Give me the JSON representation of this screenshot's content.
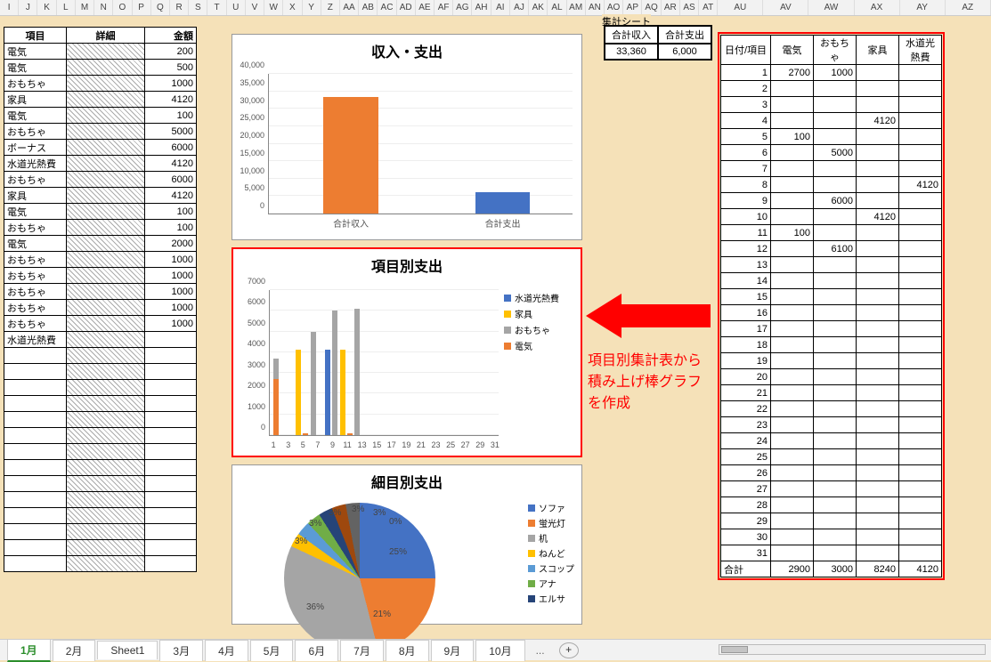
{
  "col_headers": [
    "I",
    "J",
    "K",
    "L",
    "M",
    "N",
    "O",
    "P",
    "Q",
    "R",
    "S",
    "T",
    "U",
    "V",
    "W",
    "X",
    "Y",
    "Z",
    "AA",
    "AB",
    "AC",
    "AD",
    "AE",
    "AF",
    "AG",
    "AH",
    "AI",
    "AJ",
    "AK",
    "AL",
    "AM",
    "AN",
    "AO",
    "AP",
    "AQ",
    "AR",
    "AS",
    "AT",
    "AU",
    "AV",
    "AW",
    "AX",
    "AY",
    "AZ"
  ],
  "left_table": {
    "headers": [
      "項目",
      "詳細",
      "金額"
    ],
    "rows": [
      [
        "電気",
        "",
        200
      ],
      [
        "電気",
        "",
        500
      ],
      [
        "おもちゃ",
        "",
        1000
      ],
      [
        "家具",
        "",
        4120
      ],
      [
        "電気",
        "",
        100
      ],
      [
        "おもちゃ",
        "",
        5000
      ],
      [
        "ボーナス",
        "",
        6000
      ],
      [
        "水道光熱費",
        "",
        4120
      ],
      [
        "おもちゃ",
        "",
        6000
      ],
      [
        "家具",
        "",
        4120
      ],
      [
        "電気",
        "",
        100
      ],
      [
        "おもちゃ",
        "",
        100
      ],
      [
        "電気",
        "",
        2000
      ],
      [
        "おもちゃ",
        "",
        1000
      ],
      [
        "おもちゃ",
        "",
        1000
      ],
      [
        "おもちゃ",
        "",
        1000
      ],
      [
        "おもちゃ",
        "",
        1000
      ],
      [
        "おもちゃ",
        "",
        1000
      ],
      [
        "水道光熱費",
        "",
        ""
      ],
      [
        "",
        "",
        ""
      ],
      [
        "",
        "",
        ""
      ],
      [
        "",
        "",
        ""
      ],
      [
        "",
        "",
        ""
      ],
      [
        "",
        "",
        ""
      ],
      [
        "",
        "",
        ""
      ],
      [
        "",
        "",
        ""
      ],
      [
        "",
        "",
        ""
      ],
      [
        "",
        "",
        ""
      ],
      [
        "",
        "",
        ""
      ],
      [
        "",
        "",
        ""
      ],
      [
        "",
        "",
        ""
      ],
      [
        "",
        "",
        ""
      ],
      [
        "",
        "",
        ""
      ]
    ]
  },
  "summary": {
    "title": "集計シート",
    "headers": [
      "合計収入",
      "合計支出"
    ],
    "values": [
      "33,360",
      "6,000"
    ]
  },
  "pivot": {
    "headers": [
      "日付/項目",
      "電気",
      "おもちゃ",
      "家具",
      "水道光熱費"
    ],
    "rows": [
      [
        1,
        2700,
        1000,
        "",
        ""
      ],
      [
        2,
        "",
        "",
        "",
        ""
      ],
      [
        3,
        "",
        "",
        "",
        ""
      ],
      [
        4,
        "",
        "",
        4120,
        ""
      ],
      [
        5,
        100,
        "",
        "",
        ""
      ],
      [
        6,
        "",
        5000,
        "",
        ""
      ],
      [
        7,
        "",
        "",
        "",
        ""
      ],
      [
        8,
        "",
        "",
        "",
        4120
      ],
      [
        9,
        "",
        6000,
        "",
        ""
      ],
      [
        10,
        "",
        "",
        4120,
        ""
      ],
      [
        11,
        100,
        "",
        "",
        ""
      ],
      [
        12,
        "",
        6100,
        "",
        ""
      ],
      [
        13,
        "",
        "",
        "",
        ""
      ],
      [
        14,
        "",
        "",
        "",
        ""
      ],
      [
        15,
        "",
        "",
        "",
        ""
      ],
      [
        16,
        "",
        "",
        "",
        ""
      ],
      [
        17,
        "",
        "",
        "",
        ""
      ],
      [
        18,
        "",
        "",
        "",
        ""
      ],
      [
        19,
        "",
        "",
        "",
        ""
      ],
      [
        20,
        "",
        "",
        "",
        ""
      ],
      [
        21,
        "",
        "",
        "",
        ""
      ],
      [
        22,
        "",
        "",
        "",
        ""
      ],
      [
        23,
        "",
        "",
        "",
        ""
      ],
      [
        24,
        "",
        "",
        "",
        ""
      ],
      [
        25,
        "",
        "",
        "",
        ""
      ],
      [
        26,
        "",
        "",
        "",
        ""
      ],
      [
        27,
        "",
        "",
        "",
        ""
      ],
      [
        28,
        "",
        "",
        "",
        ""
      ],
      [
        29,
        "",
        "",
        "",
        ""
      ],
      [
        30,
        "",
        "",
        "",
        ""
      ],
      [
        31,
        "",
        "",
        "",
        ""
      ]
    ],
    "total_label": "合計",
    "totals": [
      2900,
      3000,
      8240,
      4120
    ]
  },
  "annotation": "項目別集計表から積み上げ棒グラフを作成",
  "tabs": [
    "1月",
    "2月",
    "Sheet1",
    "3月",
    "4月",
    "5月",
    "6月",
    "7月",
    "8月",
    "9月",
    "10月"
  ],
  "active_tab": 0,
  "tab_more": "...",
  "chart1_xticks": [
    "合計収入",
    "合計支出"
  ],
  "chart2_legend": [
    "水道光熱費",
    "家具",
    "おもちゃ",
    "電気"
  ],
  "chart3_legend": [
    "ソファ",
    "蛍光灯",
    "机",
    "ねんど",
    "スコップ",
    "アナ",
    "エルサ"
  ],
  "chart_data": [
    {
      "type": "bar",
      "title": "収入・支出",
      "categories": [
        "合計収入",
        "合計支出"
      ],
      "values": [
        33360,
        6000
      ],
      "ylim": [
        0,
        40000
      ],
      "yticks": [
        0,
        5000,
        10000,
        15000,
        20000,
        25000,
        30000,
        35000,
        40000
      ],
      "colors": [
        "#ed7d31",
        "#4472c4"
      ]
    },
    {
      "type": "bar_stacked",
      "title": "項目別支出",
      "x": [
        1,
        3,
        5,
        7,
        9,
        11,
        13,
        15,
        17,
        19,
        21,
        23,
        25,
        27,
        29,
        31
      ],
      "series": [
        {
          "name": "水道光熱費",
          "color": "#4472c4"
        },
        {
          "name": "家具",
          "color": "#ffc000"
        },
        {
          "name": "おもちゃ",
          "color": "#a5a5a5"
        },
        {
          "name": "電気",
          "color": "#ed7d31"
        }
      ],
      "data_by_day": {
        "1": {
          "電気": 2700,
          "おもちゃ": 1000
        },
        "4": {
          "家具": 4120
        },
        "5": {
          "電気": 100
        },
        "6": {
          "おもちゃ": 5000
        },
        "8": {
          "水道光熱費": 4120
        },
        "9": {
          "おもちゃ": 6000
        },
        "10": {
          "家具": 4120
        },
        "11": {
          "電気": 100
        },
        "12": {
          "おもちゃ": 6100
        }
      },
      "ylim": [
        0,
        7000
      ],
      "yticks": [
        0,
        1000,
        2000,
        3000,
        4000,
        5000,
        6000,
        7000
      ]
    },
    {
      "type": "pie",
      "title": "細目別支出",
      "slices": [
        {
          "name": "ソファ",
          "pct": 25,
          "color": "#4472c4"
        },
        {
          "name": "蛍光灯",
          "pct": 21,
          "color": "#ed7d31"
        },
        {
          "name": "机",
          "pct": 36,
          "color": "#a5a5a5"
        },
        {
          "name": "ねんど",
          "pct": 3,
          "color": "#ffc000"
        },
        {
          "name": "スコップ",
          "pct": 3,
          "color": "#5b9bd5"
        },
        {
          "name": "アナ",
          "pct": 3,
          "color": "#70ad47"
        },
        {
          "name": "エルサ",
          "pct": 3,
          "color": "#264478"
        },
        {
          "name": "",
          "pct": 3,
          "color": "#9e480e"
        },
        {
          "name": "",
          "pct": 3,
          "color": "#636363"
        },
        {
          "name": "",
          "pct": 0,
          "color": "#997300"
        }
      ]
    }
  ]
}
